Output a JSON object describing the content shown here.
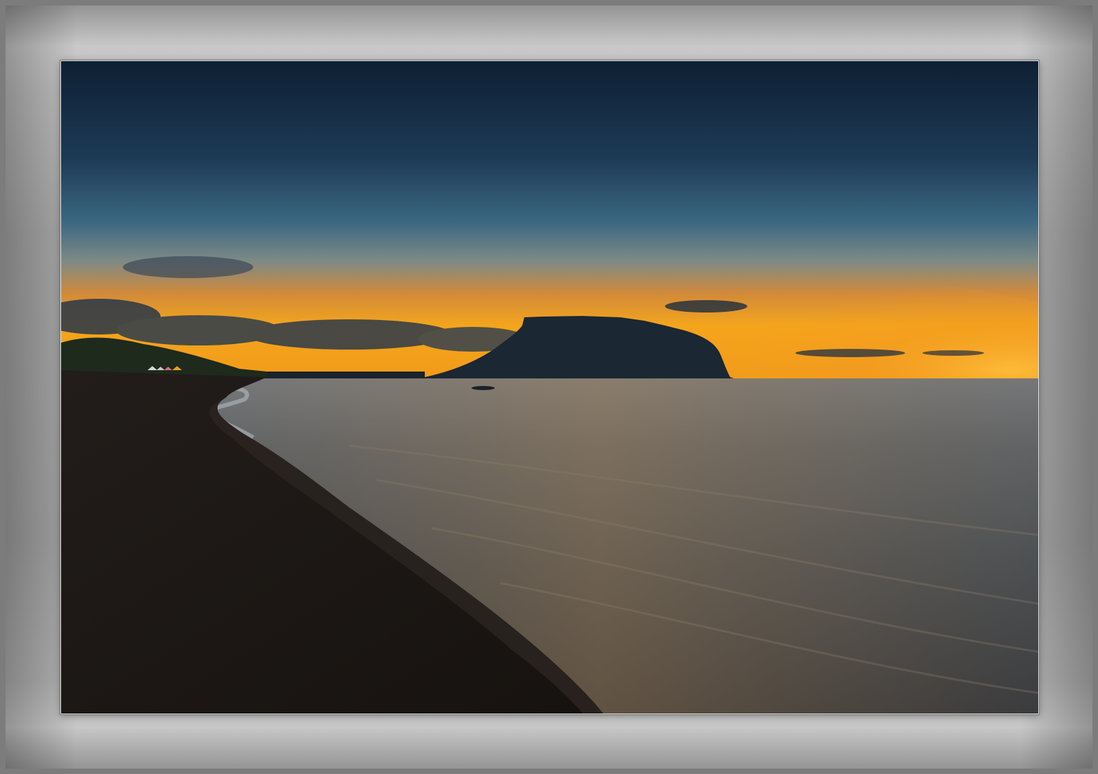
{
  "scene": {
    "subject": "sunset-coastline",
    "colors": {
      "frame": "#a9a9a9",
      "sky_top": "#10233a",
      "sky_mid": "#2f5a78",
      "horizon_glow": "#f0a020",
      "sea": "#4a5a66",
      "beach": "#1b1714",
      "headland": "#1c2a36"
    }
  }
}
